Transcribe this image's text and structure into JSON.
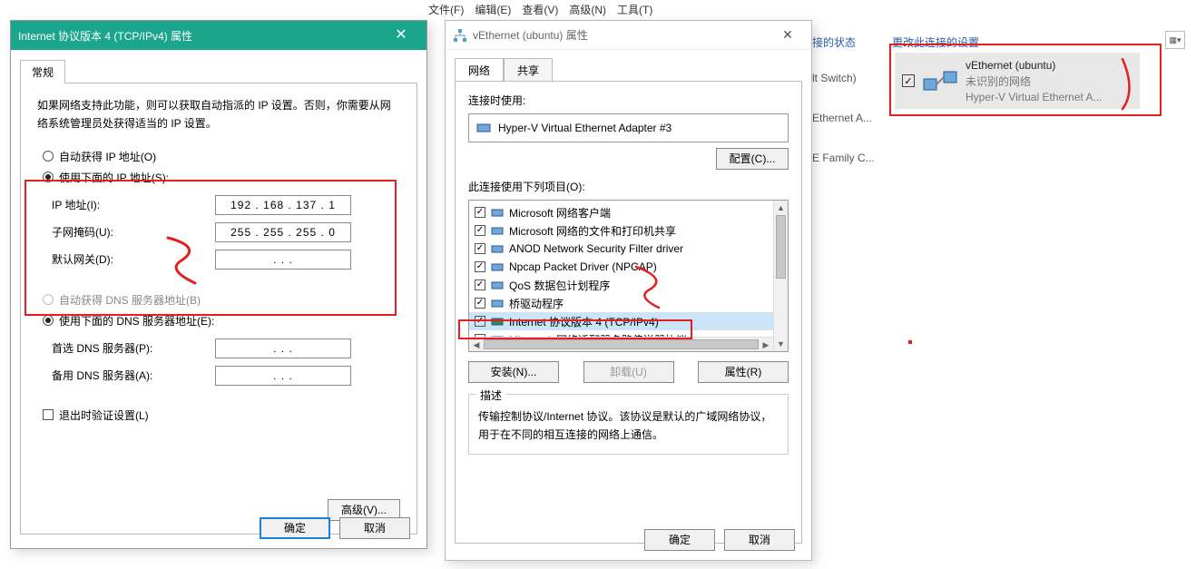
{
  "bg": {
    "menu": [
      "文件(F)",
      "编辑(E)",
      "查看(V)",
      "高级(N)",
      "工具(T)"
    ],
    "header_status": "接的状态",
    "header_change": "更改此连接的设置",
    "rows": [
      {
        "l1": "lt Switch)",
        "l2": ""
      },
      {
        "l1": "Ethernet A...",
        "l2": ""
      },
      {
        "l1": "E Family C...",
        "l2": ""
      }
    ]
  },
  "card": {
    "name": "vEthernet (ubuntu)",
    "status": "未识别的网络",
    "device": "Hyper-V Virtual Ethernet A..."
  },
  "dlg2": {
    "title": "vEthernet (ubuntu) 属性",
    "tabs": [
      "网络",
      "共享"
    ],
    "connect_using": "连接时使用:",
    "adapter": "Hyper-V Virtual Ethernet Adapter #3",
    "configure": "配置(C)...",
    "items_label": "此连接使用下列项目(O):",
    "items": [
      {
        "checked": true,
        "label": "Microsoft 网络客户端",
        "sel": false
      },
      {
        "checked": true,
        "label": "Microsoft 网络的文件和打印机共享",
        "sel": false
      },
      {
        "checked": true,
        "label": "ANOD Network Security Filter driver",
        "sel": false
      },
      {
        "checked": true,
        "label": "Npcap Packet Driver (NPCAP)",
        "sel": false
      },
      {
        "checked": true,
        "label": "QoS 数据包计划程序",
        "sel": false
      },
      {
        "checked": true,
        "label": "桥驱动程序",
        "sel": false
      },
      {
        "checked": true,
        "label": "Internet 协议版本 4 (TCP/IPv4)",
        "sel": true
      },
      {
        "checked": false,
        "label": "Microsoft 网络适配器多路传送器协议",
        "sel": false
      }
    ],
    "install": "安装(N)...",
    "uninstall": "卸载(U)",
    "props": "属性(R)",
    "desc_legend": "描述",
    "desc": "传输控制协议/Internet 协议。该协议是默认的广域网络协议，用于在不同的相互连接的网络上通信。",
    "ok": "确定",
    "cancel": "取消"
  },
  "dlg1": {
    "title": "Internet 协议版本 4 (TCP/IPv4) 属性",
    "tab": "常规",
    "info": "如果网络支持此功能，则可以获取自动指派的 IP 设置。否则，你需要从网络系统管理员处获得适当的 IP 设置。",
    "auto_ip": "自动获得 IP 地址(O)",
    "use_ip": "使用下面的 IP 地址(S):",
    "ip_label": "IP 地址(I):",
    "ip_value": "192 . 168 . 137 .   1",
    "mask_label": "子网掩码(U):",
    "mask_value": "255 . 255 . 255 .   0",
    "gw_label": "默认网关(D):",
    "gw_value": "   .       .       .   ",
    "auto_dns": "自动获得 DNS 服务器地址(B)",
    "use_dns": "使用下面的 DNS 服务器地址(E):",
    "dns1_label": "首选 DNS 服务器(P):",
    "dns2_label": "备用 DNS 服务器(A):",
    "dns_blank": "   .       .       .   ",
    "validate": "退出时验证设置(L)",
    "advanced": "高级(V)...",
    "ok": "确定",
    "cancel": "取消"
  }
}
